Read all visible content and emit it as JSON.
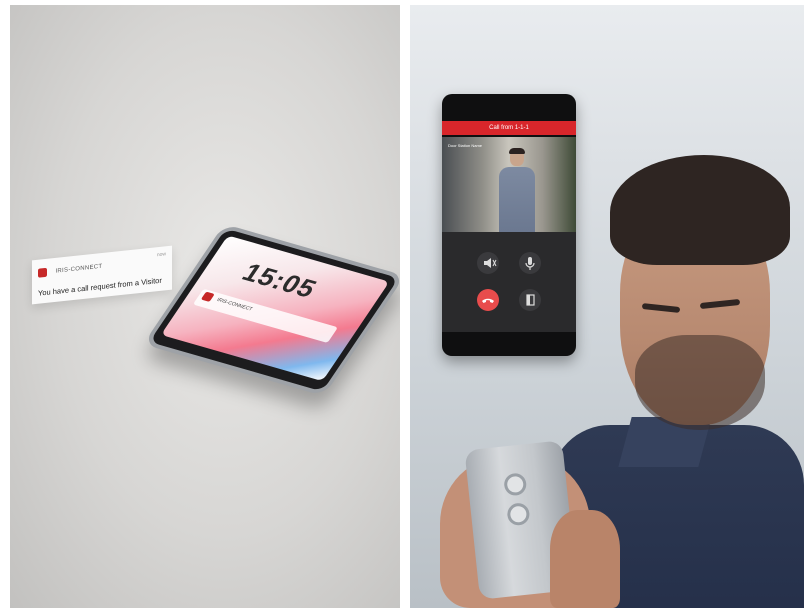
{
  "left_scene": {
    "phone_clock": "15:05",
    "phone_notification_app": "IRIS-CONNECT",
    "floating_notification": {
      "app_name": "IRIS-CONNECT",
      "time_label": "now",
      "message": "You have a call request from a Visitor"
    }
  },
  "right_scene": {
    "call_header": "Call from 1-1-1",
    "video_overlay_text": "Door Station Name",
    "controls": {
      "speaker_icon": "speaker-mute-icon",
      "mic_icon": "microphone-icon",
      "end_call_icon": "phone-hangup-icon",
      "door_icon": "door-icon"
    }
  },
  "colors": {
    "accent_red": "#d8262b",
    "end_call_red": "#e84c4c"
  }
}
